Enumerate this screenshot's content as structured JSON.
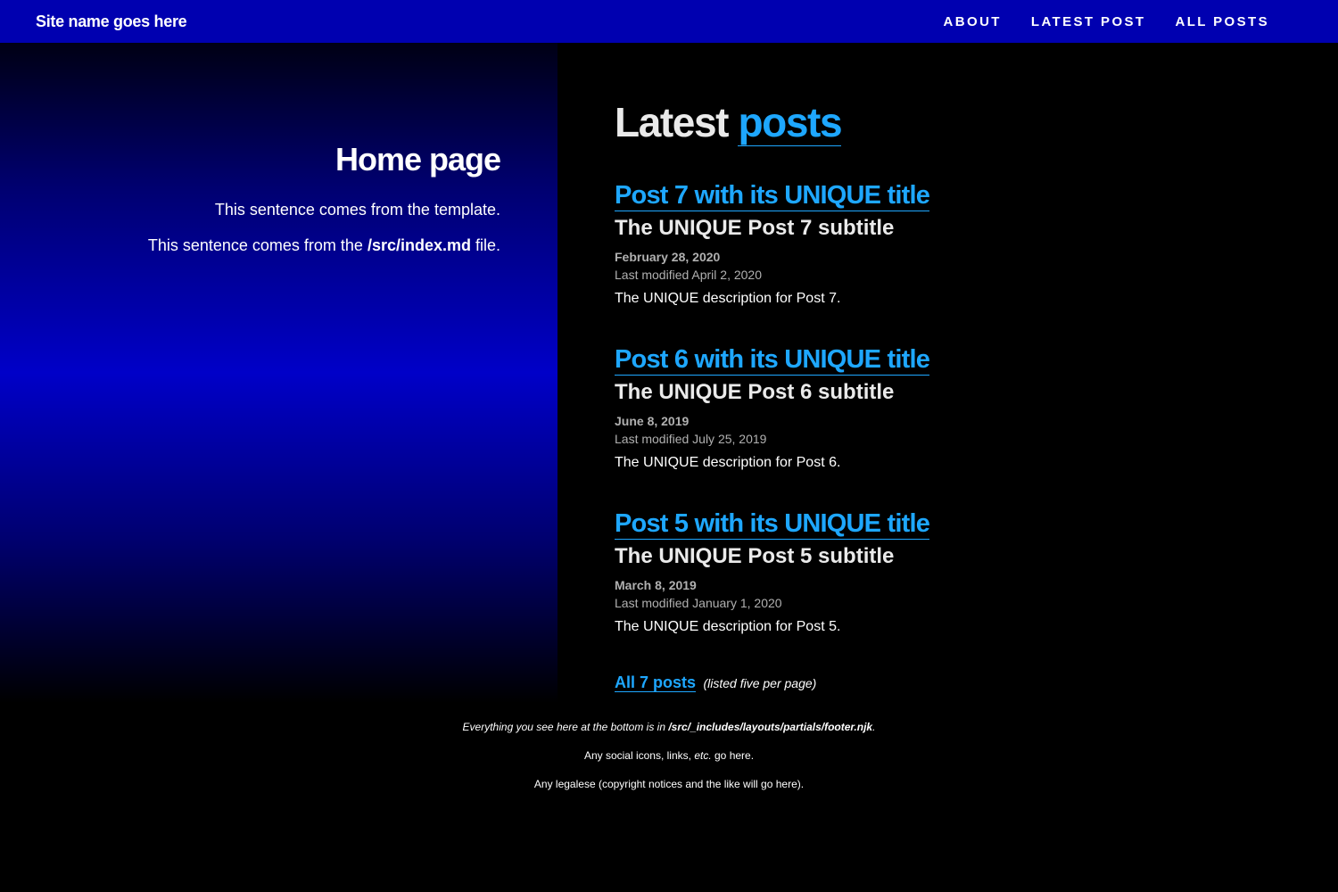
{
  "header": {
    "site_name": "Site name goes here",
    "nav": [
      "ABOUT",
      "LATEST POST",
      "ALL POSTS"
    ]
  },
  "home": {
    "title": "Home page",
    "sentence_1": "This sentence comes from the template.",
    "sentence_2_prefix": "This sentence comes from the ",
    "sentence_2_file": "/src/index.md",
    "sentence_2_suffix": " file."
  },
  "latest": {
    "heading_plain": "Latest ",
    "heading_link": "posts"
  },
  "posts": [
    {
      "title": "Post 7 with its UNIQUE title",
      "subtitle": "The UNIQUE Post 7 subtitle",
      "date": "February 28, 2020",
      "modified": "Last modified April 2, 2020",
      "description": "The UNIQUE description for Post 7."
    },
    {
      "title": "Post 6 with its UNIQUE title",
      "subtitle": "The UNIQUE Post 6 subtitle",
      "date": "June 8, 2019",
      "modified": "Last modified July 25, 2019",
      "description": "The UNIQUE description for Post 6."
    },
    {
      "title": "Post 5 with its UNIQUE title",
      "subtitle": "The UNIQUE Post 5 subtitle",
      "date": "March 8, 2019",
      "modified": "Last modified January 1, 2020",
      "description": "The UNIQUE description for Post 5."
    }
  ],
  "all_posts": {
    "link": "All 7 posts",
    "note": "(listed five per page)"
  },
  "footer": {
    "line1_prefix": "Everything you see here at the bottom is in ",
    "line1_path": "/src/_includes/layouts/partials/footer.njk",
    "line1_suffix": ".",
    "line2_prefix": "Any social icons, links, ",
    "line2_etc": "etc.",
    "line2_suffix": " go here.",
    "line3": "Any legalese (copyright notices and the like will go here)."
  },
  "colors": {
    "header_bg": "#0000b0",
    "link": "#1ea7ff",
    "page_bg": "#000000"
  }
}
